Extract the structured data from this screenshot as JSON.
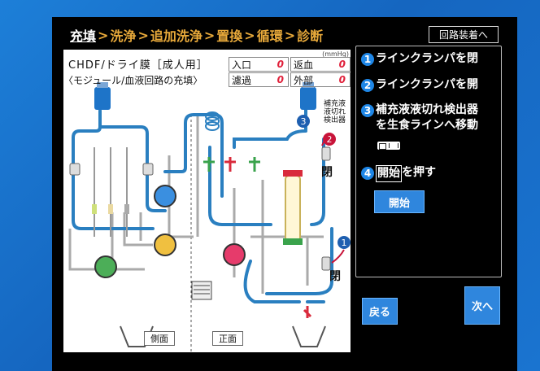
{
  "header": {
    "steps": [
      "充填",
      "洗浄",
      "追加洗浄",
      "置換",
      "循環",
      "診断"
    ],
    "separator": ">",
    "mount_button": "回路装着へ"
  },
  "diagram": {
    "title1": "CHDF/ドライ膜［成人用］",
    "title2": "〈モジュール/血液回路の充填〉",
    "unit": "(mmHg)",
    "pressures": [
      {
        "label": "入口",
        "value": "0"
      },
      {
        "label": "返血",
        "value": "0"
      },
      {
        "label": "濾過",
        "value": "0"
      },
      {
        "label": "外部",
        "value": "0"
      }
    ],
    "bag_note": [
      "補充液",
      "液切れ",
      "検出器"
    ],
    "side_label": "側面",
    "front_label": "正面",
    "close_label_top": "閉",
    "close_label_bottom": "閉",
    "callouts": [
      "3",
      "2",
      "1"
    ]
  },
  "instructions": {
    "step1": {
      "num": "1",
      "text": "ラインクランパを閉"
    },
    "step2": {
      "num": "2",
      "text": "ラインクランパを開"
    },
    "step3": {
      "num": "3",
      "line1": "補充液液切れ検出器",
      "line2": "を生食ラインへ移動"
    },
    "step4": {
      "num": "4",
      "boxed": "開始",
      "rest": "を押す"
    }
  },
  "buttons": {
    "start": "開始",
    "back": "戻る",
    "next": "次へ"
  },
  "colors": {
    "tube": "#2a7fc0",
    "accent_orange": "#e8a93a",
    "button_blue": "#2f86dd",
    "value_red": "#e0203a"
  }
}
